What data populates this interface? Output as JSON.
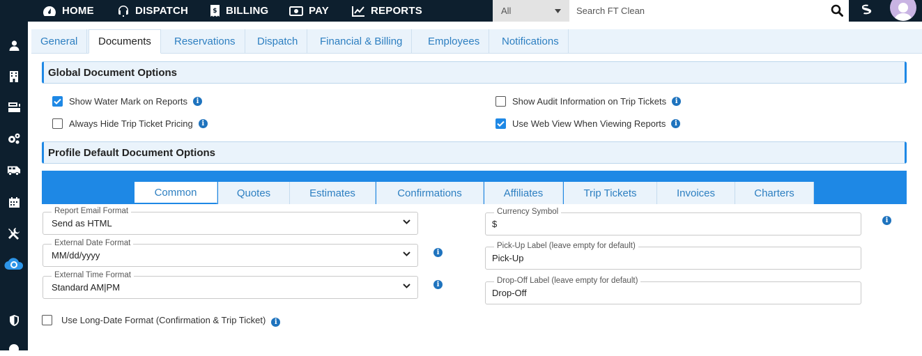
{
  "topnav": {
    "home": "HOME",
    "dispatch": "DISPATCH",
    "billing": "BILLING",
    "pay": "PAY",
    "reports": "REPORTS"
  },
  "search": {
    "scope_value": "All",
    "placeholder": "Search FT Clean"
  },
  "tabs": [
    "General",
    "Documents",
    "Reservations",
    "Dispatch",
    "Financial & Billing",
    "Employees",
    "Notifications"
  ],
  "active_tab": "Documents",
  "global_section": {
    "title": "Global Document Options",
    "options": [
      {
        "label": "Show Water Mark on Reports",
        "checked": true
      },
      {
        "label": "Always Hide Trip Ticket Pricing",
        "checked": false
      },
      {
        "label": "Show Audit Information on Trip Tickets",
        "checked": false
      },
      {
        "label": "Use Web View When Viewing Reports",
        "checked": true
      }
    ]
  },
  "profile_section": {
    "title": "Profile Default Document Options",
    "subtabs": [
      "Common",
      "Quotes",
      "Estimates",
      "Confirmations",
      "Affiliates",
      "Trip Tickets",
      "Invoices",
      "Charters"
    ],
    "active_subtab": "Common"
  },
  "fields": {
    "report_email_format": {
      "label": "Report Email Format",
      "value": "Send as HTML"
    },
    "external_date_format": {
      "label": "External Date Format",
      "value": "MM/dd/yyyy"
    },
    "external_time_format": {
      "label": "External Time Format",
      "value": "Standard AM|PM"
    },
    "currency_symbol": {
      "label": "Currency Symbol",
      "value": "$"
    },
    "pickup_label": {
      "label": "Pick-Up Label (leave empty for default)",
      "value": "Pick-Up"
    },
    "dropoff_label": {
      "label": "Drop-Off Label (leave empty for default)",
      "value": "Drop-Off"
    }
  },
  "long_date": {
    "label": "Use Long-Date Format (Confirmation & Trip Ticket)",
    "checked": false
  },
  "colors": {
    "nav_bg": "#0d1f2e",
    "accent": "#1e88e5",
    "tab_text": "#2d7fc1"
  }
}
